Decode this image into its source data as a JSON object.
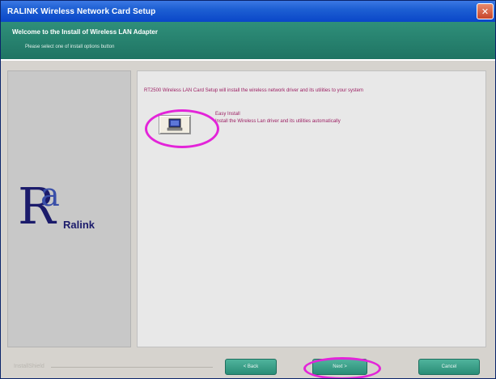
{
  "window": {
    "title": "RALINK Wireless Network Card Setup"
  },
  "banner": {
    "title": "Welcome to the Install of Wireless LAN Adapter",
    "subtitle": "Please select one of install options button"
  },
  "brand": {
    "logo_text": "Ralink",
    "footer_label": "InstallShield"
  },
  "content": {
    "intro": "RT2500 Wireless LAN Card Setup will install the wireless network driver and its utilities to your system",
    "option": {
      "title": "Easy Install",
      "description": "Install the Wireless Lan driver and its utilities automatically"
    }
  },
  "buttons": {
    "back": "< Back",
    "next": "Next >",
    "cancel": "Cancel"
  },
  "colors": {
    "titlebar": "#0a46c8",
    "banner": "#1f7463",
    "text_accent": "#9c1f63",
    "highlight": "#e324d9",
    "button": "#2a8d77"
  }
}
